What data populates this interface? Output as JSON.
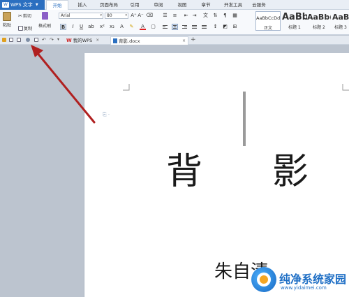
{
  "app": {
    "name": "WPS 文字",
    "logo_text": "W"
  },
  "menu": [
    "开始",
    "插入",
    "页面布局",
    "引用",
    "审阅",
    "视图",
    "章节",
    "开发工具",
    "云服务"
  ],
  "menu_active_index": 0,
  "ribbon": {
    "paste": "粘贴",
    "cut": "剪切",
    "copy": "复制",
    "format_painter": "格式刷",
    "font_name": "Arial",
    "font_size": "80",
    "bold": "B",
    "italic": "I",
    "underline": "U",
    "grow": "A⁺",
    "shrink": "A⁻",
    "font_color": "A",
    "styles": [
      {
        "preview": "AaBbCcDd",
        "label": "正文"
      },
      {
        "preview": "AaBb",
        "label": "标题 1"
      },
      {
        "preview": "AaBb(",
        "label": "标题 2"
      },
      {
        "preview": "AaBb",
        "label": "标题 3"
      }
    ]
  },
  "tabs": [
    {
      "label": "我的WPS",
      "active": false
    },
    {
      "label": "背影.docx",
      "active": true
    }
  ],
  "new_tab": "+",
  "close": "×",
  "document": {
    "title_chars": [
      "背",
      "影"
    ],
    "author": "朱自清",
    "para_mark": "⎘ ·"
  },
  "watermark": {
    "title": "纯净系统家园",
    "url": "www.yidaimei.com"
  },
  "colors": {
    "accent": "#2b6fc0",
    "arrow": "#b02020",
    "workspace": "#bcc4cf"
  },
  "icons": [
    "scissors-icon",
    "copy-icon",
    "format-painter-icon",
    "paste-icon",
    "open-icon",
    "save-icon",
    "print-icon",
    "undo-icon",
    "redo-icon"
  ]
}
